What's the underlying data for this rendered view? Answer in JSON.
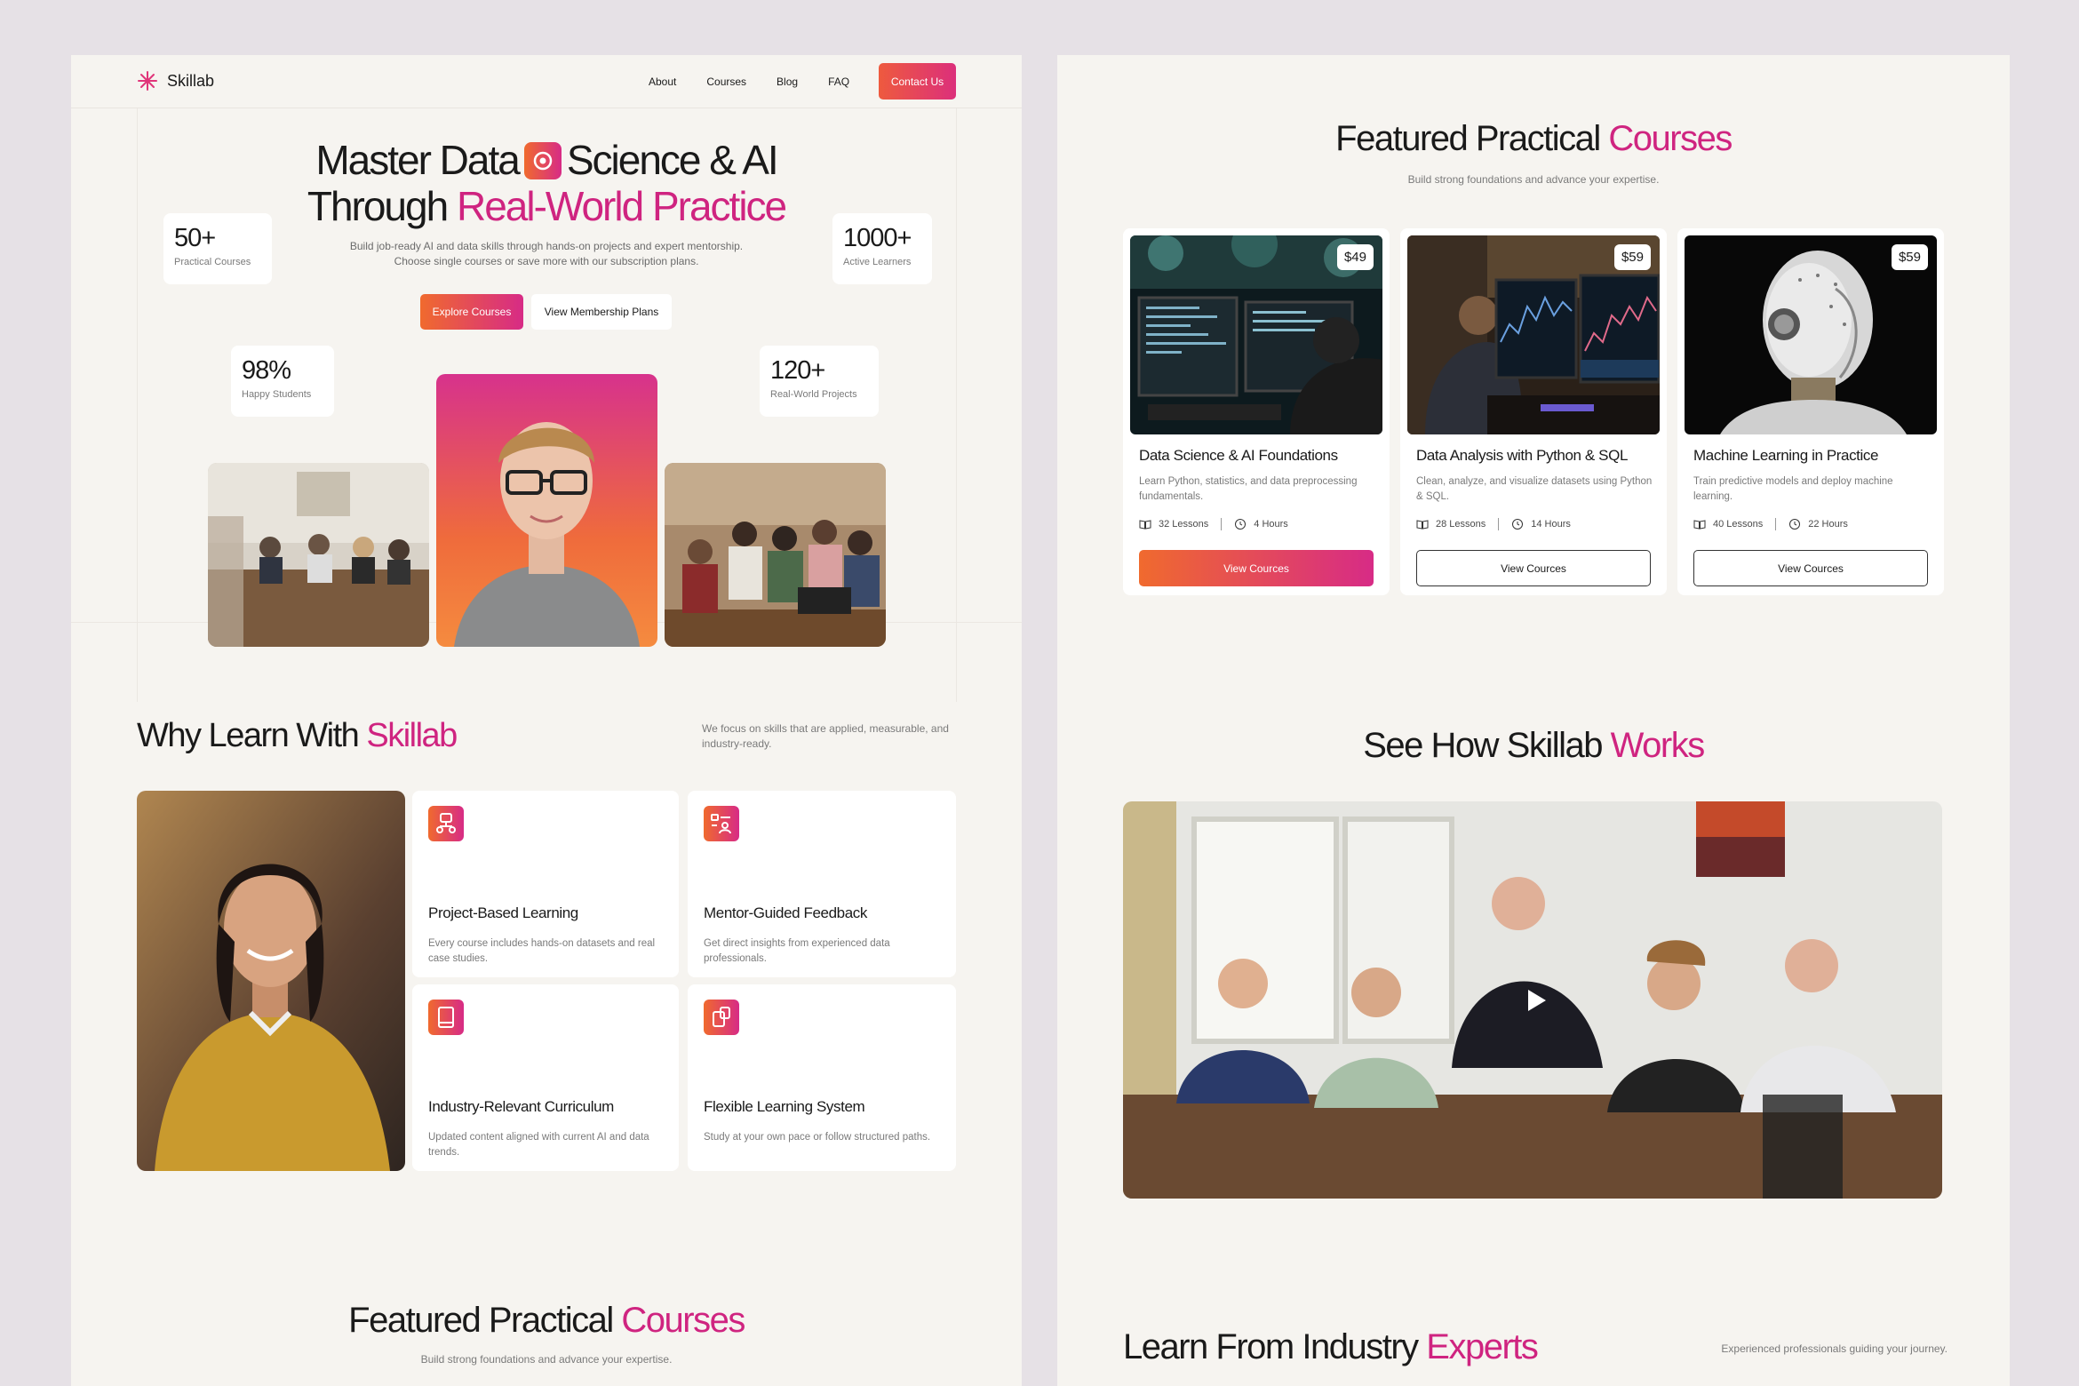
{
  "brand": {
    "name": "Skillab",
    "accent": "#cf2480",
    "gradient_start": "#f06a2e",
    "gradient_end": "#d72b86"
  },
  "nav": {
    "links": [
      "About",
      "Courses",
      "Blog",
      "FAQ"
    ],
    "cta": "Contact Us"
  },
  "hero": {
    "title_line1_a": "Master Data",
    "title_line1_b": "Science & AI",
    "title_line2_a": "Through",
    "title_line2_b": "Real-World Practice",
    "subtitle_1": "Build job-ready AI and data skills through hands-on projects and expert mentorship.",
    "subtitle_2": "Choose single courses or save more with our subscription plans.",
    "btn_primary": "Explore Courses",
    "btn_secondary": "View Membership Plans",
    "stats": [
      {
        "num": "50+",
        "label": "Practical Courses"
      },
      {
        "num": "1000+",
        "label": "Active Learners"
      },
      {
        "num": "98%",
        "label": "Happy Students"
      },
      {
        "num": "120+",
        "label": "Real-World Projects"
      }
    ]
  },
  "why": {
    "title_a": "Why Learn With",
    "title_b": "Skillab",
    "desc": "We focus on skills that are applied, measurable, and industry-ready.",
    "features": [
      {
        "icon": "project-flow-icon",
        "title": "Project-Based Learning",
        "desc": "Every course includes hands-on datasets and real case studies."
      },
      {
        "icon": "mentor-icon",
        "title": "Mentor-Guided Feedback",
        "desc": "Get direct insights from experienced data professionals."
      },
      {
        "icon": "book-icon",
        "title": "Industry-Relevant Curriculum",
        "desc": "Updated content aligned with current AI and data trends."
      },
      {
        "icon": "flexible-icon",
        "title": "Flexible Learning System",
        "desc": "Study at your own pace or follow structured paths."
      }
    ]
  },
  "featured_left": {
    "title_a": "Featured Practical",
    "title_b": "Courses",
    "subtitle": "Build strong foundations and advance your expertise."
  },
  "featured": {
    "title_a": "Featured Practical",
    "title_b": "Courses",
    "subtitle": "Build strong foundations and advance your expertise.",
    "courses": [
      {
        "price": "$49",
        "title": "Data Science & AI Foundations",
        "desc": "Learn Python, statistics, and data preprocessing fundamentals.",
        "lessons": "32 Lessons",
        "hours": "4 Hours",
        "btn": "View Cources"
      },
      {
        "price": "$59",
        "title": "Data Analysis with Python & SQL",
        "desc": "Clean, analyze, and visualize datasets using Python & SQL.",
        "lessons": "28 Lessons",
        "hours": "14 Hours",
        "btn": "View Cources"
      },
      {
        "price": "$59",
        "title": "Machine Learning in Practice",
        "desc": "Train predictive models and deploy machine learning.",
        "lessons": "40 Lessons",
        "hours": "22 Hours",
        "btn": "View Cources"
      }
    ]
  },
  "how": {
    "title_a": "See How Skillab",
    "title_b": "Works"
  },
  "experts": {
    "title_a": "Learn From Industry",
    "title_b": "Experts",
    "desc": "Experienced professionals guiding your journey."
  }
}
